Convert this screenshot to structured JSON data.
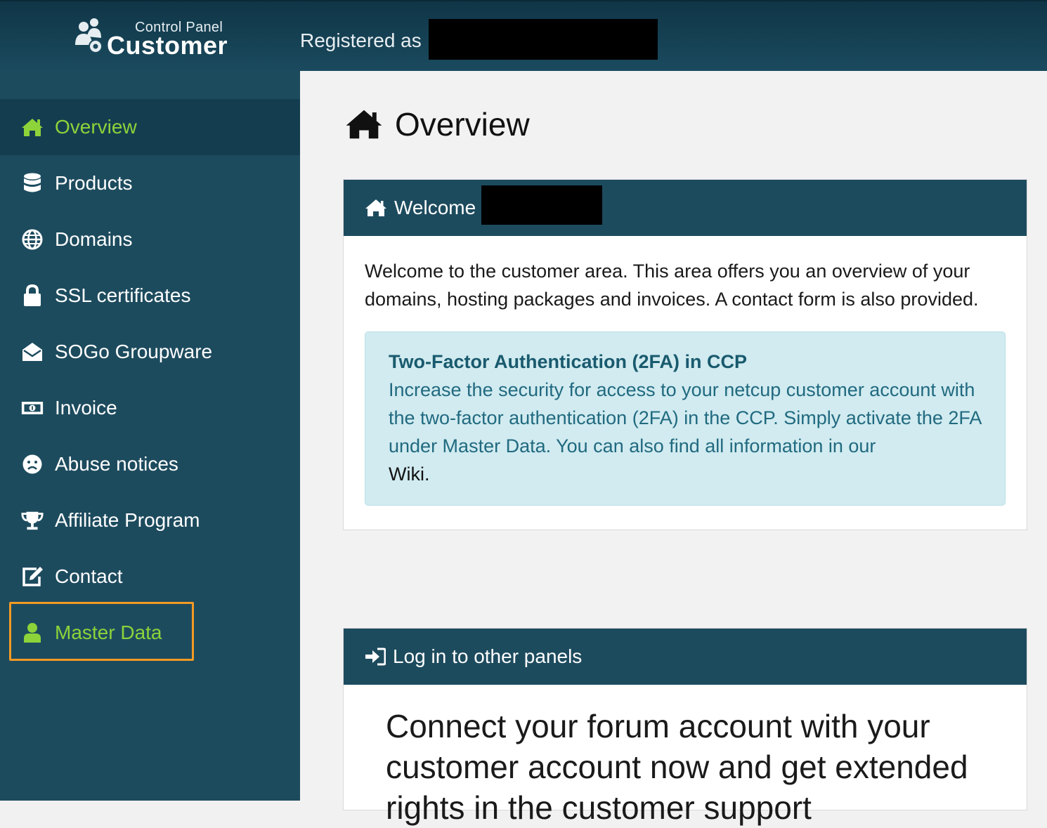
{
  "header": {
    "logo_small": "Control Panel",
    "logo_big": "Customer",
    "registered_label": "Registered as"
  },
  "sidebar": {
    "items": [
      {
        "label": "Overview",
        "icon": "home-icon"
      },
      {
        "label": "Products",
        "icon": "database-icon"
      },
      {
        "label": "Domains",
        "icon": "globe-icon"
      },
      {
        "label": "SSL certificates",
        "icon": "lock-icon"
      },
      {
        "label": "SOGo Groupware",
        "icon": "envelope-open-icon"
      },
      {
        "label": "Invoice",
        "icon": "money-bill-icon"
      },
      {
        "label": "Abuse notices",
        "icon": "frown-icon"
      },
      {
        "label": "Affiliate Program",
        "icon": "trophy-icon"
      },
      {
        "label": "Contact",
        "icon": "edit-icon"
      },
      {
        "label": "Master Data",
        "icon": "user-icon"
      }
    ]
  },
  "main": {
    "title": "Overview",
    "welcome_card": {
      "heading": "Welcome",
      "text": "Welcome to the customer area. This area offers you an overview of your domains, hosting packages and invoices. A contact form is also provided.",
      "alert_title": "Two-Factor Authentication (2FA) in CCP",
      "alert_text": "Increase the security for access to your netcup customer account with the two-factor authentication (2FA) in the CCP. Simply activate the 2FA under Master Data. You can also find all information in our",
      "alert_link": "Wiki."
    },
    "panels_card": {
      "heading": "Log in to other panels",
      "text": "Connect your forum account with your customer account now and get extended rights in the customer support"
    }
  },
  "colors": {
    "sidebar_bg": "#1d4b5e",
    "active_green": "#8dd33a",
    "highlight_orange": "#f39a24",
    "alert_bg": "#d1ebf0"
  }
}
